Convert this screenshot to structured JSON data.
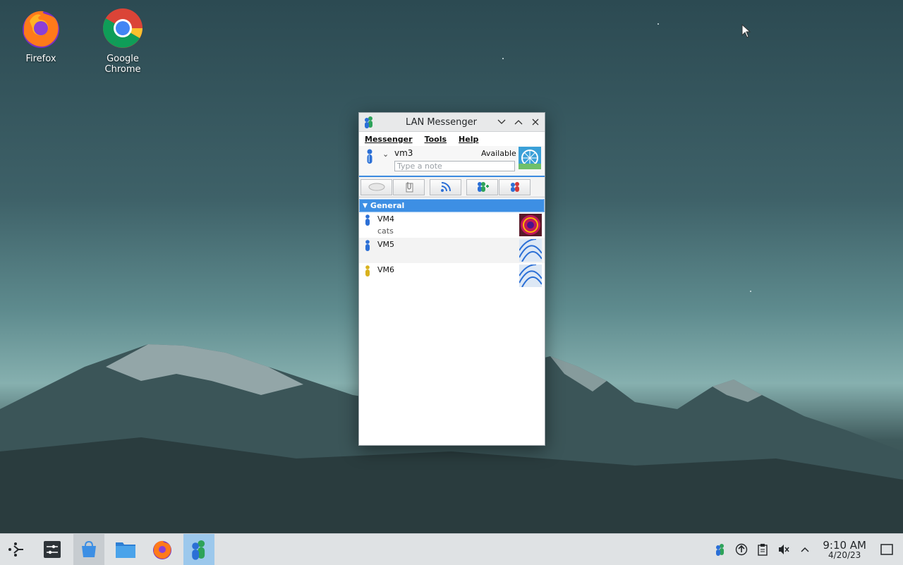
{
  "desktop": {
    "icons": [
      {
        "label": "Firefox",
        "icon": "firefox-icon"
      },
      {
        "label": "Google Chrome",
        "icon": "chrome-icon"
      }
    ]
  },
  "window": {
    "title": "LAN Messenger",
    "menu": [
      "Messenger",
      "Tools",
      "Help"
    ],
    "user": {
      "name": "vm3",
      "status": "Available",
      "note_placeholder": "Type a note"
    },
    "toolbar_icons": [
      "broadcast-icon",
      "file-transfer-icon",
      "rss-icon",
      "add-contact-icon",
      "group-chat-icon"
    ],
    "group": "General",
    "contacts": [
      {
        "name": "VM4",
        "note": "cats",
        "status_color": "#2b6fd6"
      },
      {
        "name": "VM5",
        "note": "",
        "status_color": "#2b6fd6"
      },
      {
        "name": "VM6",
        "note": "",
        "status_color": "#d9b21d"
      }
    ]
  },
  "taskbar": {
    "clock_time": "9:10 AM",
    "clock_date": "4/20/23"
  },
  "colors": {
    "accent": "#3d8fe4"
  }
}
